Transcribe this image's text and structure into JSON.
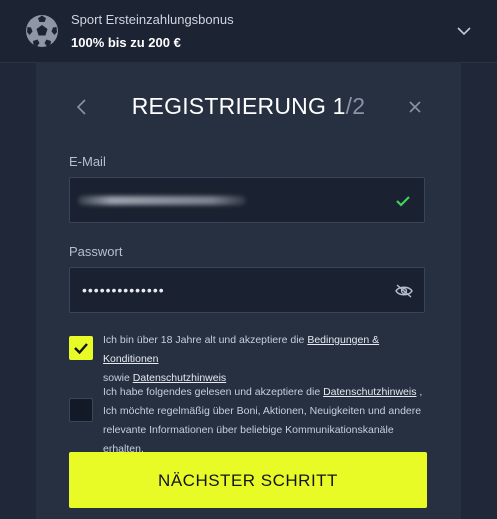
{
  "bonus": {
    "title": "Sport Ersteinzahlungsbonus",
    "amount": "100% bis zu 200 €",
    "icon": "football-icon",
    "toggle_icon": "chevron-down-icon"
  },
  "header": {
    "title": "REGISTRIERUNG",
    "step_current": "1",
    "step_total": "/2",
    "back_icon": "chevron-left-icon",
    "close_icon": "close-icon"
  },
  "email": {
    "label": "E-Mail",
    "value_state": "blurred",
    "valid_icon": "checkmark-icon"
  },
  "password": {
    "label": "Passwort",
    "value": "••••••••••••••",
    "toggle_icon": "eye-slash-icon"
  },
  "consent_age": {
    "checked": true,
    "text_before": "Ich bin über 18 Jahre alt und akzeptiere die",
    "link_terms": "Bedingungen & Konditionen",
    "text_middle": "sowie",
    "link_privacy": "Datenschutzhinweis"
  },
  "consent_marketing": {
    "checked": false,
    "text_before": "Ich habe folgendes gelesen und akzeptiere die",
    "link_privacy": "Datenschutzhinweis",
    "text_after": ", Ich möchte regelmäßig über Boni, Aktionen, Neuigkeiten und andere relevante Informationen über beliebige Kommunikationskanäle erhalten."
  },
  "cta": {
    "label": "NÄCHSTER SCHRITT"
  },
  "colors": {
    "accent": "#e9fb26",
    "background": "#1f2738",
    "panel": "#263041",
    "valid": "#3fd35a"
  }
}
